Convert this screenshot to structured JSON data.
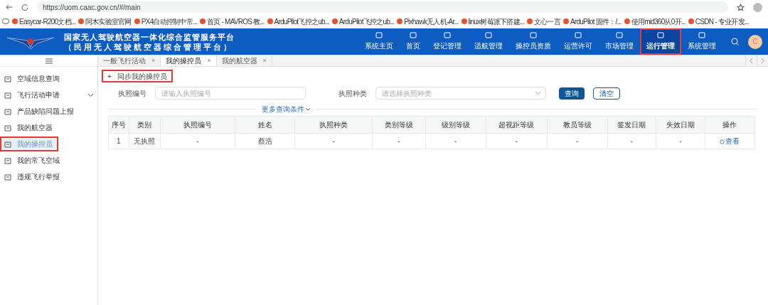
{
  "browser": {
    "url": "https://uom.caac.gov.cn/#/main",
    "bookmarks": [
      {
        "label": "Easycar-R200文档..."
      },
      {
        "label": "阿木实验室官网"
      },
      {
        "label": "PX4自动控制中常..."
      },
      {
        "label": "首页 - MAVROS 教..."
      },
      {
        "label": "ArduPilot飞控之ub..."
      },
      {
        "label": "ArduPilot飞控之ub..."
      },
      {
        "label": "Pixhawk无人机-Ar..."
      },
      {
        "label": "linux树莓派下搭建..."
      },
      {
        "label": "文心一言"
      },
      {
        "label": "ArduPilot 固件：/..."
      },
      {
        "label": "使用mid360从0开..."
      },
      {
        "label": "CSDN - 专业开发..."
      }
    ]
  },
  "header": {
    "title": "国家无人驾驶航空器一体化综合监管服务平台",
    "subtitle": "（民用无人驾驶航空器综合管理平台）",
    "nav": [
      {
        "label": "系统主页",
        "selected": false,
        "highlighted": false
      },
      {
        "label": "首页",
        "selected": false,
        "highlighted": false
      },
      {
        "label": "登记管理",
        "selected": false,
        "highlighted": false
      },
      {
        "label": "适航管理",
        "selected": false,
        "highlighted": false
      },
      {
        "label": "操控员资质",
        "selected": false,
        "highlighted": false
      },
      {
        "label": "运营许可",
        "selected": false,
        "highlighted": false
      },
      {
        "label": "市场管理",
        "selected": false,
        "highlighted": false
      },
      {
        "label": "运行管理",
        "selected": true,
        "highlighted": true
      },
      {
        "label": "系统管理",
        "selected": false,
        "highlighted": false
      }
    ],
    "avatar": "C"
  },
  "tabs": [
    {
      "label": "一般飞行活动",
      "close": "×",
      "selected": false
    },
    {
      "label": "我的操控员",
      "close": "×",
      "selected": true
    },
    {
      "label": "我的航空器",
      "close": "×",
      "selected": false
    }
  ],
  "sidebar": {
    "items": [
      {
        "label": "空域信息查询",
        "selected": false,
        "highlighted": false,
        "expandable": false
      },
      {
        "label": "飞行活动申请",
        "selected": false,
        "highlighted": false,
        "expandable": true
      },
      {
        "label": "产品缺陷问题上报",
        "selected": false,
        "highlighted": false,
        "expandable": false
      },
      {
        "label": "我的航空器",
        "selected": false,
        "highlighted": false,
        "expandable": false
      },
      {
        "label": "我的操控员",
        "selected": true,
        "highlighted": true,
        "expandable": false
      },
      {
        "label": "我的常飞空域",
        "selected": false,
        "highlighted": false,
        "expandable": false
      },
      {
        "label": "违规飞行举报",
        "selected": false,
        "highlighted": false,
        "expandable": false
      }
    ]
  },
  "sync_button": {
    "icon": "+",
    "label": "同步我的操控员",
    "highlighted": true
  },
  "filters": {
    "license_number": {
      "label": "执照编号",
      "placeholder": "请输入执照编号"
    },
    "license_type": {
      "label": "执照种类",
      "placeholder": "请选择执照种类"
    },
    "search_button": "查询",
    "clear_button": "清空",
    "more_conditions": "更多查询条件"
  },
  "table": {
    "columns": [
      "序号",
      "类别",
      "执照编号",
      "姓名",
      "执照种类",
      "类别等级",
      "级别等级",
      "超视距等级",
      "教员等级",
      "签发日期",
      "失效日期",
      "操作"
    ],
    "rows": [
      {
        "cells": [
          "1",
          "无执照",
          "-",
          "蔡浩",
          "-",
          "-",
          "-",
          "-",
          "-",
          "-",
          "-"
        ],
        "action": "查看"
      }
    ]
  }
}
